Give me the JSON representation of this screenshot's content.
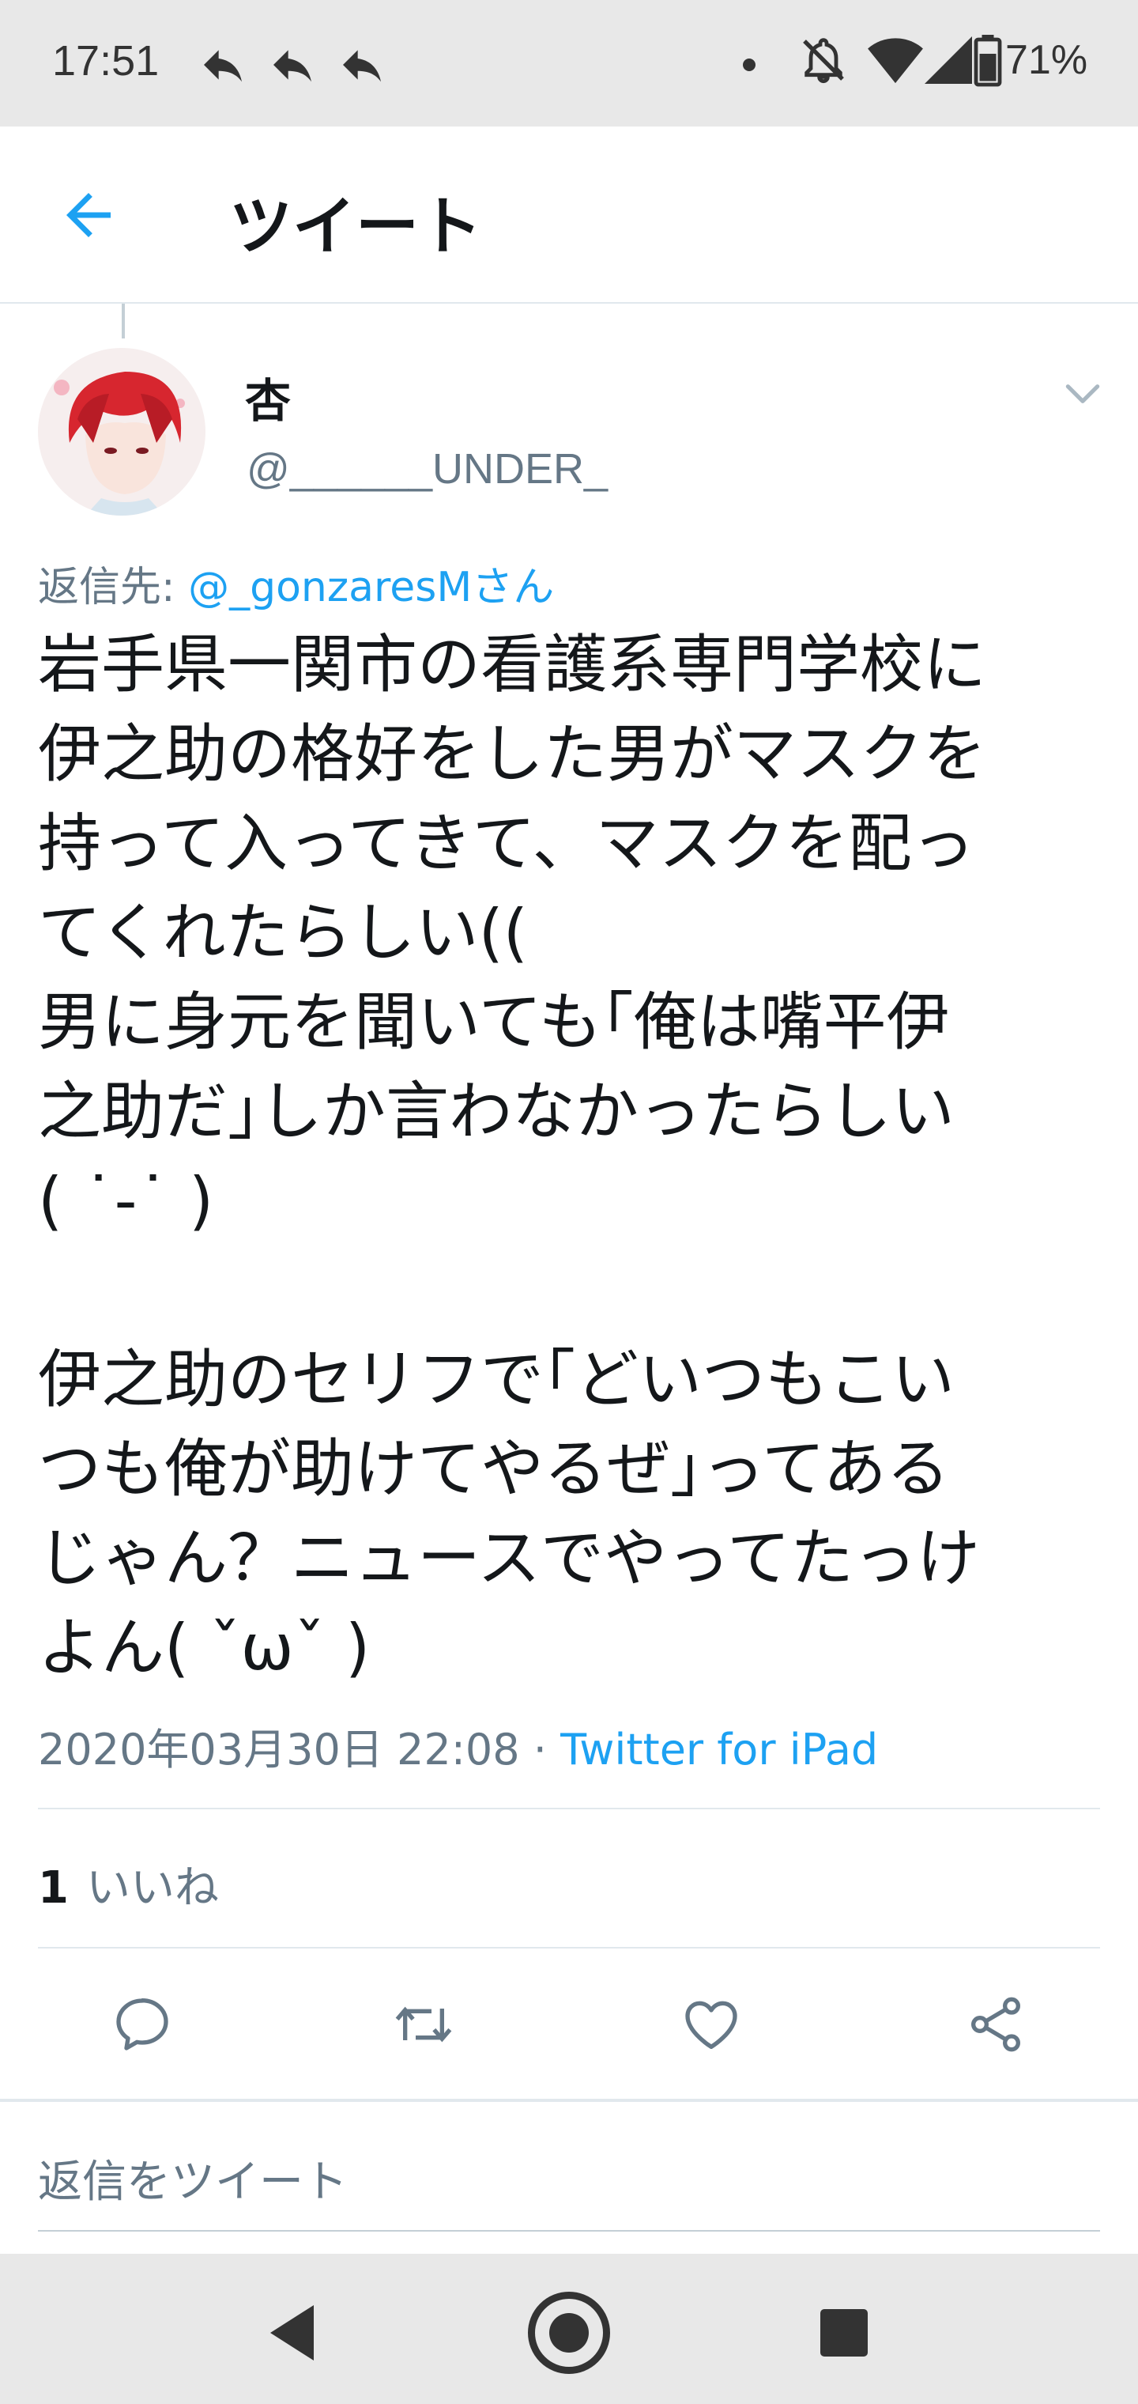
{
  "status_bar": {
    "time": "17:51",
    "battery": "71%",
    "icons": [
      "reply-notification-icon",
      "reply-notification-icon",
      "reply-notification-icon",
      "dot-icon",
      "mute-icon",
      "wifi-icon",
      "signal-icon",
      "battery-icon"
    ]
  },
  "app_bar": {
    "title": "ツイート",
    "back_icon": "arrow-left-icon"
  },
  "tweet": {
    "user": {
      "name": "杏",
      "handle": "@______UNDER_"
    },
    "reply_to_label": "返信先: ",
    "reply_to_mention": "@_gonzaresMさん",
    "body": "岩手県一関市の看護系専門学校に\n伊之助の格好をした男がマスクを\n持って入ってきて、マスクを配っ\nてくれたらしい((\n男に身元を聞いても｢俺は嘴平伊\n之助だ｣しか言わなかったらしい\n( ˙-˙ )\n\n伊之助のセリフで｢どいつもこい\nつも俺が助けてやるぜ｣ってある\nじゃん？ニュースでやってたっけ\nよん( ˇωˇ )",
    "timestamp": "2020年03月30日 22:08",
    "separator": " · ",
    "source": "Twitter for iPad",
    "likes_count": "1",
    "likes_label": "いいね"
  },
  "actions": {
    "reply": "reply-icon",
    "retweet": "retweet-icon",
    "like": "heart-icon",
    "share": "share-icon"
  },
  "reply_box": {
    "placeholder": "返信をツイート"
  },
  "colors": {
    "accent": "#1da1f2",
    "secondary_text": "#657786",
    "primary_text": "#14171a"
  }
}
